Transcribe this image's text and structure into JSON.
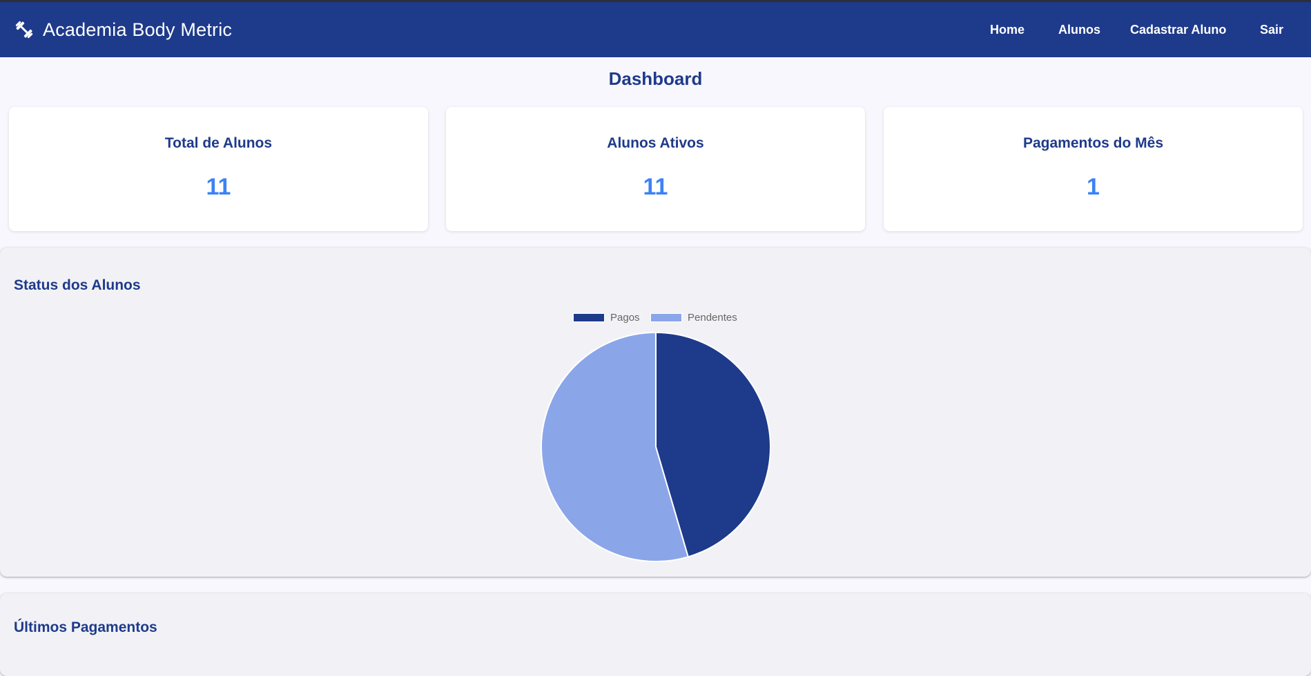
{
  "app": {
    "brand": "Academia Body Metric",
    "brand_icon": "dumbbell-icon"
  },
  "nav": {
    "items": [
      {
        "label": "Home"
      },
      {
        "label": "Alunos"
      },
      {
        "label": "Cadastrar Aluno"
      },
      {
        "label": "Sair"
      }
    ]
  },
  "main": {
    "title": "Dashboard",
    "cards": [
      {
        "title": "Total de Alunos",
        "value": "11"
      },
      {
        "title": "Alunos Ativos",
        "value": "11"
      },
      {
        "title": "Pagamentos do Mês",
        "value": "1"
      }
    ],
    "status_panel": {
      "title": "Status dos Alunos"
    },
    "payments_panel": {
      "title": "Últimos Pagamentos"
    }
  },
  "colors": {
    "nav_bg": "#1e3a8a",
    "accent_value": "#3b82f6",
    "pagos": "#1e3a8a",
    "pendentes": "#8ba5e9"
  },
  "chart_data": {
    "type": "pie",
    "categories": [
      "Pagos",
      "Pendentes"
    ],
    "values": [
      5,
      6
    ],
    "colors": [
      "#1e3a8a",
      "#8ba5e9"
    ],
    "legend": "top"
  }
}
